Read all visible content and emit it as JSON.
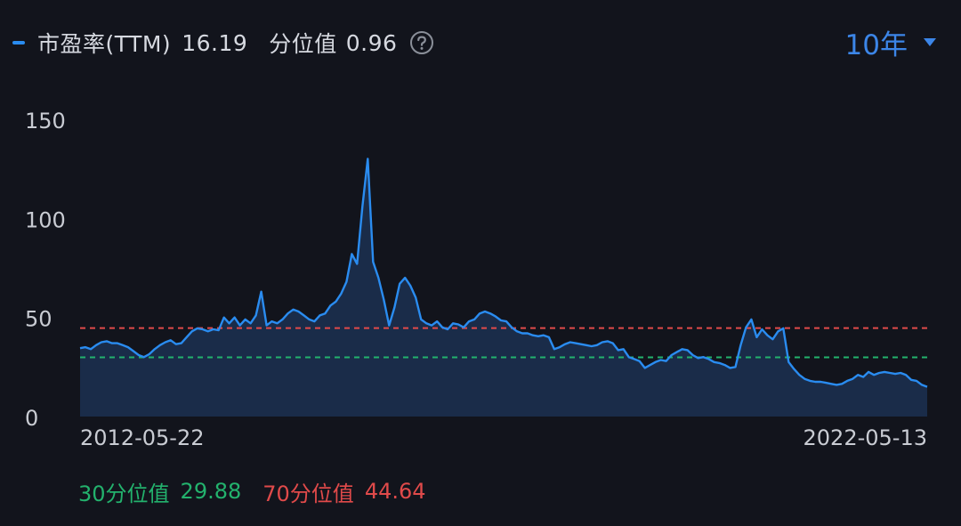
{
  "header": {
    "metric_label": "市盈率(TTM)",
    "metric_value": "16.19",
    "percentile_label": "分位值",
    "percentile_value": "0.96",
    "help_icon": "question-circle-icon",
    "range_label": "10年",
    "range_icon": "caret-down-icon"
  },
  "footer": {
    "p30_label": "30分位值",
    "p30_value": "29.88",
    "p70_label": "70分位值",
    "p70_value": "44.64"
  },
  "colors": {
    "line": "#2a8cf0",
    "area": "#1b2d4c",
    "p30": "#23b26d",
    "p70": "#e04a4a",
    "axis_text": "#c9ccd3",
    "accent": "#3c86e8"
  },
  "chart_data": {
    "type": "area",
    "x_start": "2012-05-22",
    "x_end": "2022-05-13",
    "x_tick_labels": [
      "2012-05-22",
      "2022-05-13"
    ],
    "y_ticks": [
      0,
      50,
      100,
      150
    ],
    "ylim": [
      0,
      150
    ],
    "grid": false,
    "series": [
      {
        "values": [
          34.5,
          35,
          34,
          36,
          37.5,
          38,
          37,
          37,
          36,
          35,
          33,
          31,
          30,
          31.5,
          34,
          36,
          37.5,
          38.5,
          36.5,
          37,
          40,
          43,
          44.5,
          44,
          43,
          44,
          43.5,
          50,
          47,
          50,
          46,
          49,
          47,
          51,
          63,
          46,
          48,
          47,
          49,
          52,
          54,
          53,
          51,
          49,
          48,
          51,
          52,
          56,
          58,
          62,
          68,
          82,
          77,
          106,
          130,
          78,
          70,
          59,
          46,
          55,
          67,
          70,
          66,
          60,
          49,
          47,
          46,
          48,
          45,
          44,
          47,
          46.5,
          45,
          48,
          49,
          52,
          53,
          52,
          50.5,
          48.5,
          48,
          45,
          43,
          42,
          42,
          41,
          40.5,
          41,
          40,
          34,
          35,
          36.5,
          37.5,
          37,
          36.5,
          36,
          35.5,
          36,
          37.5,
          38,
          37,
          33.5,
          34,
          30,
          29,
          28,
          24.5,
          26,
          27.5,
          28.5,
          28,
          31,
          32.5,
          34,
          33.5,
          31,
          29.5,
          30,
          29,
          27.5,
          27,
          26,
          24.5,
          25,
          36,
          45,
          49,
          40,
          44,
          41,
          39,
          43,
          44.5,
          27.5,
          24,
          21,
          19,
          18,
          17.5,
          17.5,
          17,
          16.5,
          16,
          16.5,
          18,
          19,
          21,
          20,
          22.5,
          21,
          22,
          22.5,
          22,
          21.5,
          22,
          21,
          18.5,
          18,
          16,
          15
        ]
      }
    ],
    "reference_lines": [
      {
        "name": "30分位值",
        "value": 29.88,
        "color": "#23b26d",
        "style": "dashed"
      },
      {
        "name": "70分位值",
        "value": 44.64,
        "color": "#e04a4a",
        "style": "dashed"
      }
    ]
  }
}
